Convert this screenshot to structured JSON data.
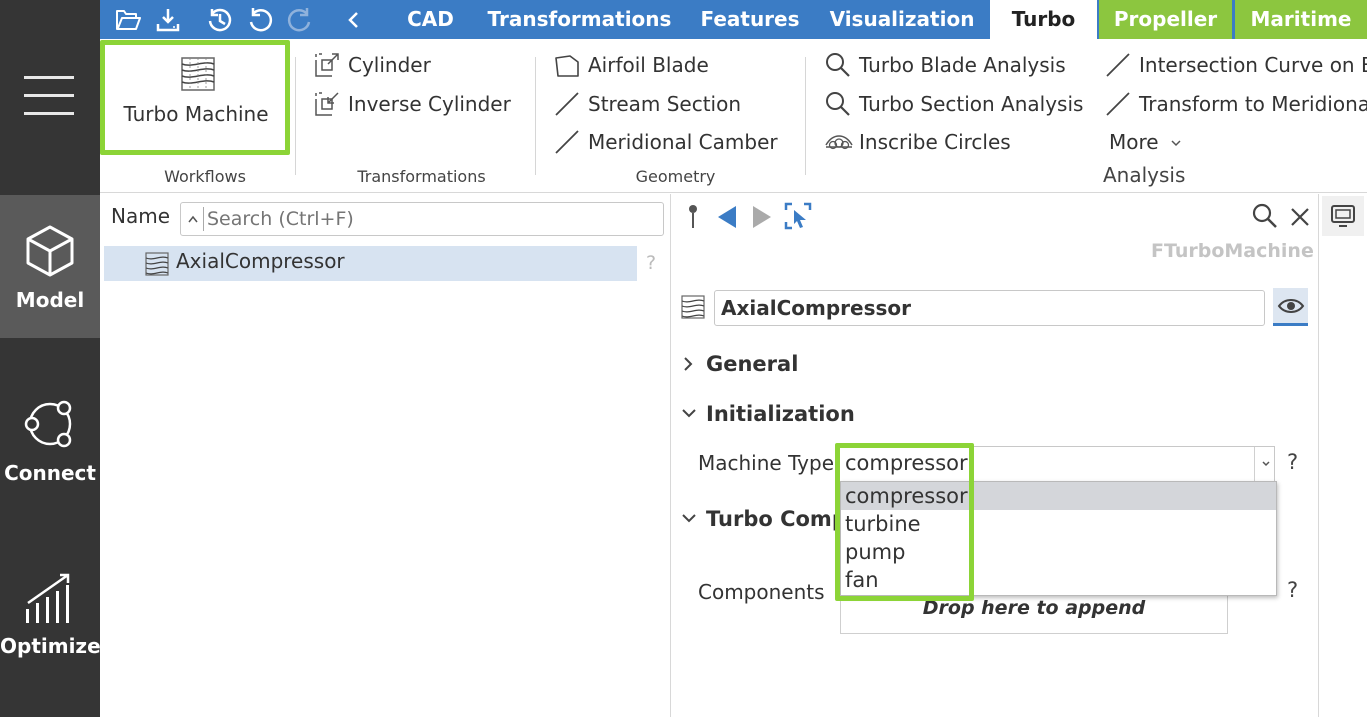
{
  "rail": {
    "items": [
      {
        "label": "Model",
        "icon": "cube-icon"
      },
      {
        "label": "Connect",
        "icon": "connect-icon"
      },
      {
        "label": "Optimize",
        "icon": "chart-bars-icon"
      }
    ]
  },
  "tabs": {
    "cad": "CAD",
    "transformations": "Transformations",
    "features": "Features",
    "visualization": "Visualization",
    "turbo": "Turbo",
    "propeller": "Propeller",
    "maritime": "Maritime"
  },
  "ribbon": {
    "turbo_machine": "Turbo Machine",
    "workflows": "Workflows",
    "cylinder": "Cylinder",
    "inverse_cylinder": "Inverse Cylinder",
    "transformations": "Transformations",
    "airfoil_blade": "Airfoil Blade",
    "stream_section": "Stream Section",
    "meridional_camber": "Meridional Camber",
    "geometry": "Geometry",
    "turbo_blade_analysis": "Turbo Blade Analysis",
    "turbo_section_analysis": "Turbo Section Analysis",
    "inscribe_circles": "Inscribe Circles",
    "intersection_curve": "Intersection Curve on B",
    "transform_meridional": "Transform to Meridiona",
    "more": "More",
    "analysis": "Analysis"
  },
  "tree": {
    "name_header": "Name",
    "search_placeholder": "Search (Ctrl+F)",
    "item": "AxialCompressor",
    "help": "?"
  },
  "props": {
    "type_label": "FTurboMachine",
    "object_name": "AxialCompressor",
    "general": "General",
    "initialization": "Initialization",
    "machine_type_label": "Machine Type",
    "machine_type_value": "compressor",
    "turbo_components": "Turbo Compo",
    "components_label": "Components",
    "drop_hint": "Drop here to append",
    "help": "?"
  },
  "dropdown": {
    "options": [
      "compressor",
      "turbine",
      "pump",
      "fan"
    ],
    "selected": "compressor"
  },
  "colors": {
    "topbar": "#3b7cc5",
    "rail": "#353535",
    "highlight": "#8cd437",
    "accent_green": "#8cc63f"
  }
}
